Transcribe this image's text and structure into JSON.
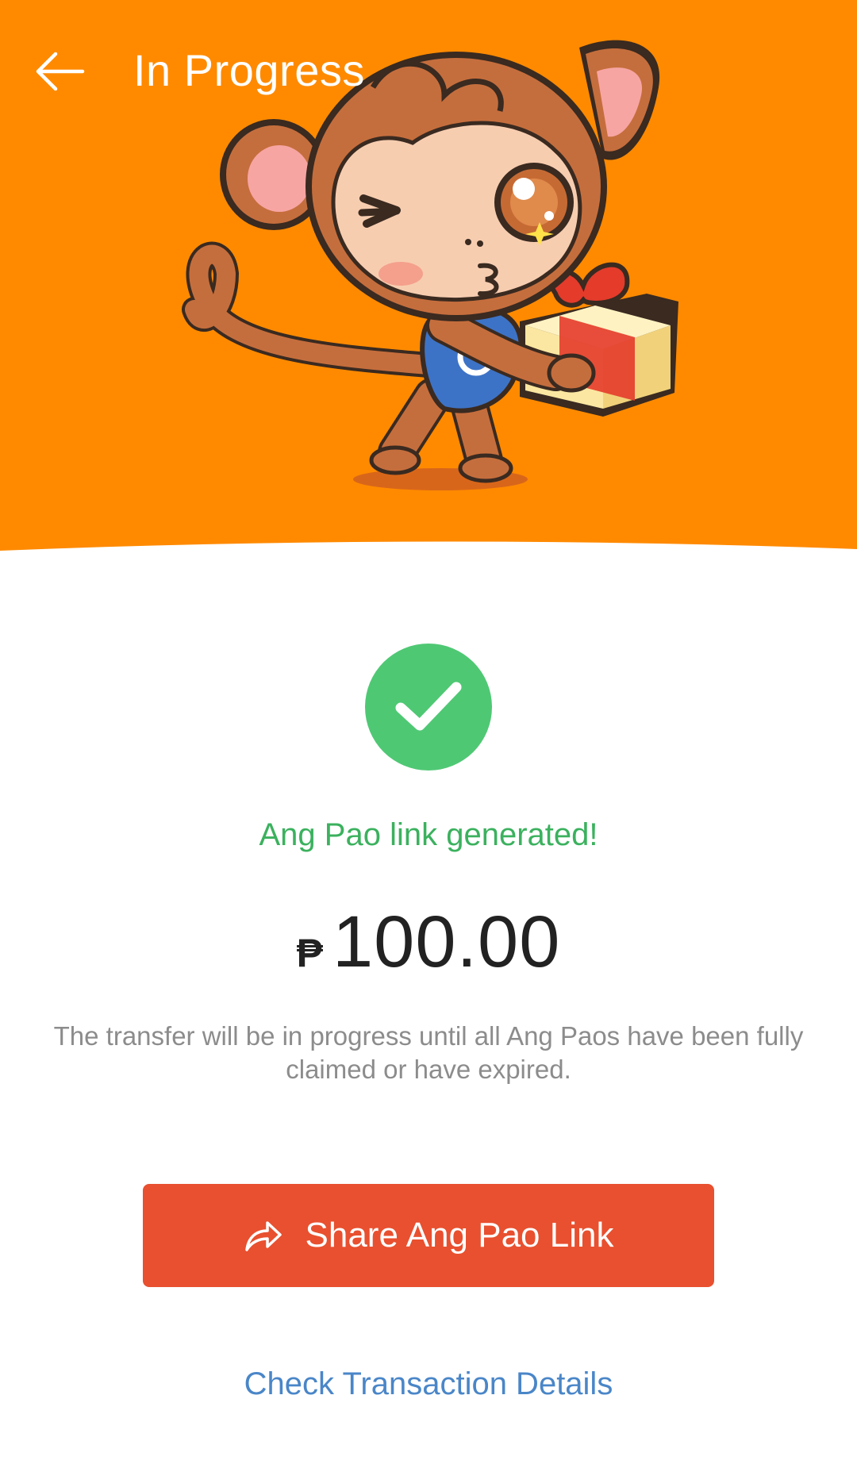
{
  "header": {
    "title": "In Progress",
    "back_icon": "arrow-left-icon"
  },
  "hero": {
    "illustration": "monkey-holding-gift-illustration",
    "background_color": "#ff8a00"
  },
  "status": {
    "icon": "checkmark-icon",
    "icon_color": "#4fc874",
    "message": "Ang Pao link generated!"
  },
  "amount": {
    "currency_symbol": "₱",
    "value": "100.00"
  },
  "note": "The transfer will be in progress until all Ang Paos have been fully claimed or have expired.",
  "actions": {
    "share_label": "Share Ang Pao Link",
    "share_icon": "share-arrow-icon",
    "share_color": "#e8502f",
    "details_label": "Check Transaction Details",
    "details_color": "#4a86c8"
  }
}
